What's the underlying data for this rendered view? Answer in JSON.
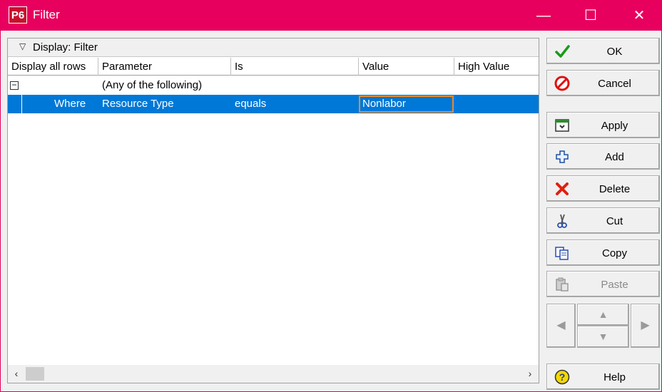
{
  "window": {
    "app_icon_text": "P6",
    "title": "Filter",
    "minimize_glyph": "—",
    "maximize_glyph": "☐",
    "close_glyph": "✕"
  },
  "grid": {
    "group_label": "Display: Filter",
    "columns": [
      "Display all rows",
      "Parameter",
      "Is",
      "Value",
      "High Value"
    ],
    "group_row": {
      "collapse_glyph": "−",
      "label": "(Any of the following)"
    },
    "rows": [
      {
        "where": "Where",
        "parameter": "Resource Type",
        "is": "equals",
        "value": "Nonlabor",
        "high_value": ""
      }
    ]
  },
  "buttons": {
    "ok": "OK",
    "cancel": "Cancel",
    "apply": "Apply",
    "add": "Add",
    "delete": "Delete",
    "cut": "Cut",
    "copy": "Copy",
    "paste": "Paste",
    "help": "Help"
  },
  "icons": {
    "ok": "check-icon",
    "cancel": "cancel-icon",
    "apply": "apply-icon",
    "add": "plus-icon",
    "delete": "delete-x-icon",
    "cut": "scissors-icon",
    "copy": "copy-icon",
    "paste": "paste-icon",
    "help": "help-icon"
  },
  "colors": {
    "titlebar": "#e8005e",
    "selection": "#0078d7",
    "edit_border": "#e88a2e"
  }
}
